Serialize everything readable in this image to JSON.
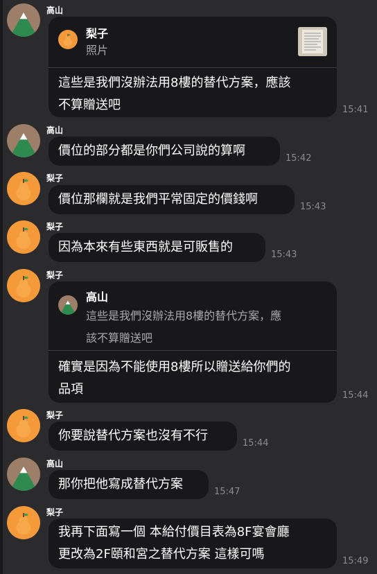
{
  "colors": {
    "background": "#2b2b2d",
    "bubble": "#18181a",
    "pear": "#f59a3a",
    "mountain_bg": "#9c7e69",
    "mountain_green": "#2f8a4f"
  },
  "messages": [
    {
      "sender": "高山",
      "avatar": "mountain-icon",
      "reply": {
        "name": "梨子",
        "avatar": "pear-icon",
        "sub": "照片",
        "thumb": "photo-thumbnail"
      },
      "text": "這些是我們沒辦法用8樓的替代方案，應該\n不算贈送吧",
      "time": "15:41"
    },
    {
      "sender": "高山",
      "avatar": "mountain-icon",
      "text": "價位的部分都是你們公司說的算啊",
      "time": "15:42"
    },
    {
      "sender": "梨子",
      "avatar": "pear-icon",
      "text": "價位那欄就是我們平常固定的價錢啊",
      "time": "15:43"
    },
    {
      "sender": "梨子",
      "avatar": "pear-icon",
      "text": "因為本來有些東西就是可販售的",
      "time": "15:43"
    },
    {
      "sender": "梨子",
      "avatar": "pear-icon",
      "reply": {
        "name": "高山",
        "avatar": "mountain-icon",
        "sub": "這些是我們沒辦法用8樓的替代方案，應\n該不算贈送吧"
      },
      "text": "確實是因為不能使用8樓所以贈送給你們的\n品項",
      "time": "15:44"
    },
    {
      "sender": "梨子",
      "avatar": "pear-icon",
      "text": "你要說替代方案也沒有不行",
      "time": "15:44"
    },
    {
      "sender": "高山",
      "avatar": "mountain-icon",
      "text": "那你把他寫成替代方案",
      "time": "15:47"
    },
    {
      "sender": "梨子",
      "avatar": "pear-icon",
      "text": "我再下面寫一個 本給付價目表為8F宴會廳\n更改為2F頤和宮之替代方案 這樣可嗎",
      "time": "15:49"
    }
  ]
}
